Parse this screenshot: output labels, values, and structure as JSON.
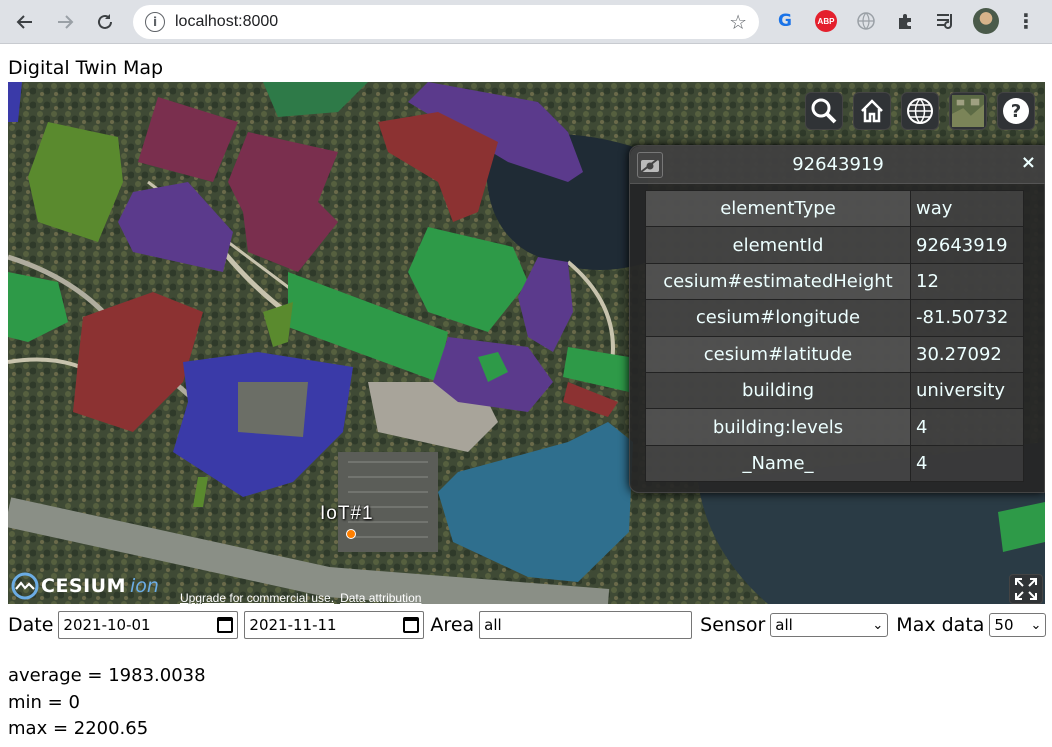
{
  "browser": {
    "url": "localhost:8000",
    "icons": [
      "back-arrow-icon",
      "forward-arrow-icon",
      "reload-icon",
      "site-info-icon",
      "bookmark-star-icon",
      "google-translate-icon",
      "adblock-plus-icon",
      "globe-extension-icon",
      "extensions-puzzle-icon",
      "reading-list-icon",
      "profile-avatar",
      "more-menu-icon"
    ],
    "abp_label": "ABP"
  },
  "page": {
    "title": "Digital Twin Map"
  },
  "map": {
    "toolbar": [
      "search-icon",
      "home-icon",
      "globe-icon",
      "base-layer-picker",
      "help-icon"
    ],
    "sensor_label": "IoT#1",
    "logo_text": "CESIUM",
    "logo_suffix": "ion",
    "credit_upgrade": "Upgrade for commercial use.",
    "credit_attribution": "Data attribution",
    "colors": {
      "purple": "#5b3a8c",
      "maroon": "#7a2f4e",
      "red": "#8c3232",
      "green": "#2e9a48",
      "olive": "#5a8a2e",
      "blue": "#3a3aa8",
      "teal": "#2f6f8e",
      "iot_dot": "#ff7f00"
    }
  },
  "infobox": {
    "title": "92643919",
    "close": "×",
    "rows": [
      {
        "key": "elementType",
        "value": "way"
      },
      {
        "key": "elementId",
        "value": "92643919"
      },
      {
        "key": "cesium#estimatedHeight",
        "value": "12"
      },
      {
        "key": "cesium#longitude",
        "value": "-81.50732"
      },
      {
        "key": "cesium#latitude",
        "value": "30.27092"
      },
      {
        "key": "building",
        "value": "university"
      },
      {
        "key": "building:levels",
        "value": "4"
      },
      {
        "key": "_Name_",
        "value": "4"
      }
    ]
  },
  "controls": {
    "date_label": "Date",
    "date_from": "2021-10-01",
    "date_to": "2021-11-11",
    "area_label": "Area",
    "area_value": "all",
    "sensor_label": "Sensor",
    "sensor_value": "all",
    "maxdata_label": "Max data",
    "maxdata_value": "50"
  },
  "stats": {
    "average": "average = 1983.0038",
    "min": "min = 0",
    "max": "max = 2200.65"
  }
}
